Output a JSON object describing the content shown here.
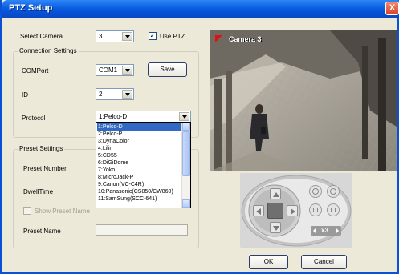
{
  "window": {
    "title": "PTZ Setup",
    "close_glyph": "X"
  },
  "camera": {
    "label": "Select Camera",
    "value": "3",
    "use_ptz_label": "Use PTZ",
    "use_ptz_checked": true
  },
  "connection": {
    "legend": "Connection Settings",
    "comport_label": "COMPort",
    "comport_value": "COM1",
    "save_label": "Save",
    "id_label": "ID",
    "id_value": "2",
    "protocol_label": "Protocol",
    "protocol_value": "1:Pelco-D",
    "protocol_options": [
      "1:Pelco-D",
      "2:Pelco-P",
      "3:DynaColor",
      "4:Lilin",
      "5:CD55",
      "6:DiGiDome",
      "7:Yoko",
      "8:MicroJack-P",
      "9:Canon(VC-C4R)",
      "10:Panasonic(CS850/CW860)",
      "11:SamSung(SCC-641)"
    ]
  },
  "preset": {
    "legend": "Preset Settings",
    "number_label": "Preset Number",
    "dwell_label": "DwellTime",
    "show_name_label": "Show Preset Name",
    "name_label": "Preset Name"
  },
  "video": {
    "camera_label": "Camera 3"
  },
  "ptz": {
    "zoom_label": "x3"
  },
  "buttons": {
    "ok": "OK",
    "cancel": "Cancel"
  }
}
